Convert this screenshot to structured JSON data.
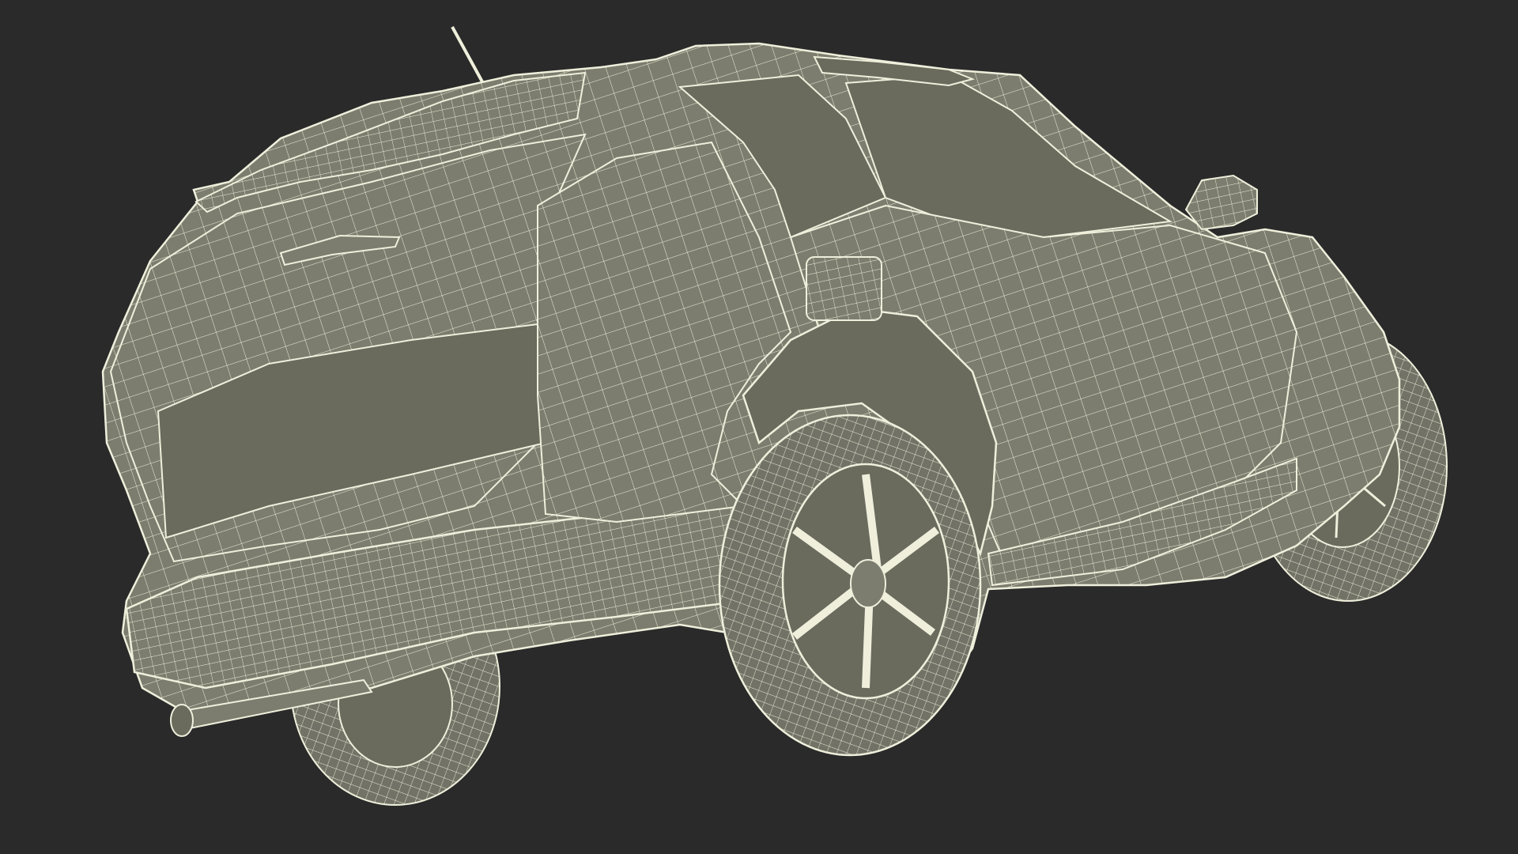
{
  "scene": {
    "background_color": "#2a2a2a",
    "body_fill": "#7d7d6f",
    "body_fill_dark": "#6a6a5d",
    "tire_fill": "#727266",
    "wire_color": "#efefdc"
  }
}
